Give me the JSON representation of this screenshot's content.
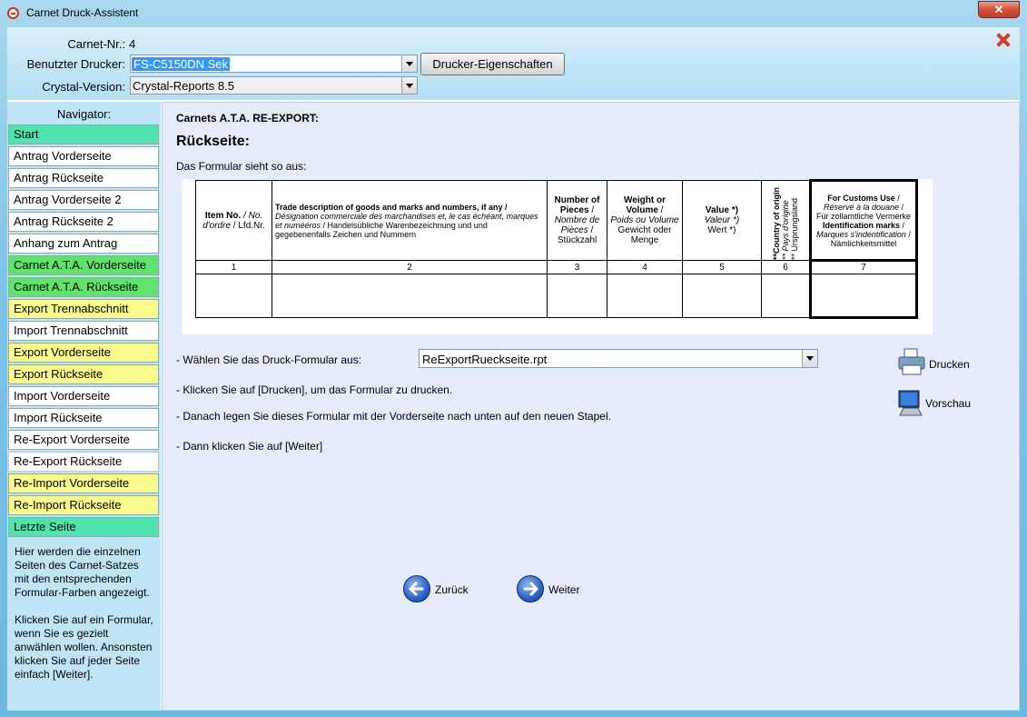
{
  "window": {
    "title": "Carnet Druck-Assistent",
    "close_glyph": "✕"
  },
  "header": {
    "carnet_label": "Carnet-Nr.:",
    "carnet_value": "4",
    "printer_label": "Benutzter Drucker:",
    "printer_value": "FS-C5150DN Sek",
    "printer_props_button": "Drucker-Eigenschaften",
    "crystal_label": "Crystal-Version:",
    "crystal_value": "Crystal-Reports 8.5"
  },
  "nav": {
    "title": "Navigator:",
    "items": [
      {
        "label": "Start",
        "color": "#4fe3b0"
      },
      {
        "label": "Antrag Vorderseite",
        "color": "#ffffff"
      },
      {
        "label": "Antrag Rückseite",
        "color": "#ffffff"
      },
      {
        "label": "Antrag Vorderseite 2",
        "color": "#ffffff"
      },
      {
        "label": "Antrag Rückseite 2",
        "color": "#ffffff"
      },
      {
        "label": "Anhang zum Antrag",
        "color": "#ffffff"
      },
      {
        "label": "Carnet A.T.A. Vorderseite",
        "color": "#5fe36a"
      },
      {
        "label": "Carnet A.T.A. Rückseite",
        "color": "#5fe36a"
      },
      {
        "label": "Export Trennabschnitt",
        "color": "#fbfb8c"
      },
      {
        "label": "Import Trennabschnitt",
        "color": "#ffffff"
      },
      {
        "label": "Export Vorderseite",
        "color": "#fbfb8c"
      },
      {
        "label": "Export Rückseite",
        "color": "#fbfb8c"
      },
      {
        "label": "Import Vorderseite",
        "color": "#ffffff"
      },
      {
        "label": "Import Rückseite",
        "color": "#ffffff"
      },
      {
        "label": "Re-Export Vorderseite",
        "color": "#ffffff"
      },
      {
        "label": "Re-Export Rückseite",
        "color": "#ffffff"
      },
      {
        "label": "Re-Import Vorderseite",
        "color": "#fbfb8c"
      },
      {
        "label": "Re-Import Rückseite",
        "color": "#fbfb8c"
      },
      {
        "label": "Letzte Seite",
        "color": "#4fe3b0"
      }
    ],
    "help_text_1": "Hier werden die einzelnen Seiten des Carnet-Satzes mit den entsprechenden Formular-Farben angezeigt.",
    "help_text_2": "Klicken Sie auf ein Formular, wenn Sie es gezielt anwählen wollen. Ansonsten klicken Sie auf jeder Seite einfach [Weiter]."
  },
  "main": {
    "section_heading": "Carnets A.T.A. RE-EXPORT:",
    "page_title": "Rückseite:",
    "formular_text": "Das Formular sieht so aus:",
    "form": {
      "c1": {
        "b": "Item No.",
        "i": " / No. d'ordre",
        "r": " / Lfd.Nr."
      },
      "c2": {
        "b": "Trade description of goods and marks and numbers, if any /",
        "i": "Désignation commerciale des marchandises et, le cas échéant, marques et numééros",
        "r": " / Handelsübliche Warenbezeichnung und und gegebenenfalls Zeichen und Nummern"
      },
      "c3": {
        "b": "Number of Pieces",
        "i": "Nombre de Pièces",
        "r": "Stückzahl"
      },
      "c4": {
        "b": "Weight or Volume",
        "i": "Poids ou Volume",
        "r": "Gewicht oder Menge"
      },
      "c5": {
        "b": "Value *)",
        "i": "Valeur *)",
        "r": "Wert *)"
      },
      "c6": {
        "b": "**Country of origin",
        "i": "** Pays d'origine",
        "r": "** Ursprungsland"
      },
      "c7": {
        "b": "For Customs Use",
        "i": "Réservé à la douane",
        "r1": "Für zollamtliche Vermerke",
        "b2": "Identification marks",
        "i2": "Marques s'indentification",
        "r2": "Nämlichkeitsmittel"
      },
      "numbers": [
        "1",
        "2",
        "3",
        "4",
        "5",
        "6",
        "7"
      ]
    },
    "choose_label": "- Wählen Sie das Druck-Formular aus:",
    "choose_value": "ReExportRueckseite.rpt",
    "instr_1": "- Klicken Sie auf [Drucken], um das Formular zu drucken.",
    "instr_2": "- Danach legen Sie dieses Formular mit der Vorderseite nach unten auf den neuen Stapel.",
    "instr_3": "- Dann klicken Sie auf [Weiter]",
    "print_button": "Drucken",
    "preview_button": "Vorschau",
    "back_button": "Zurück",
    "next_button": "Weiter"
  }
}
